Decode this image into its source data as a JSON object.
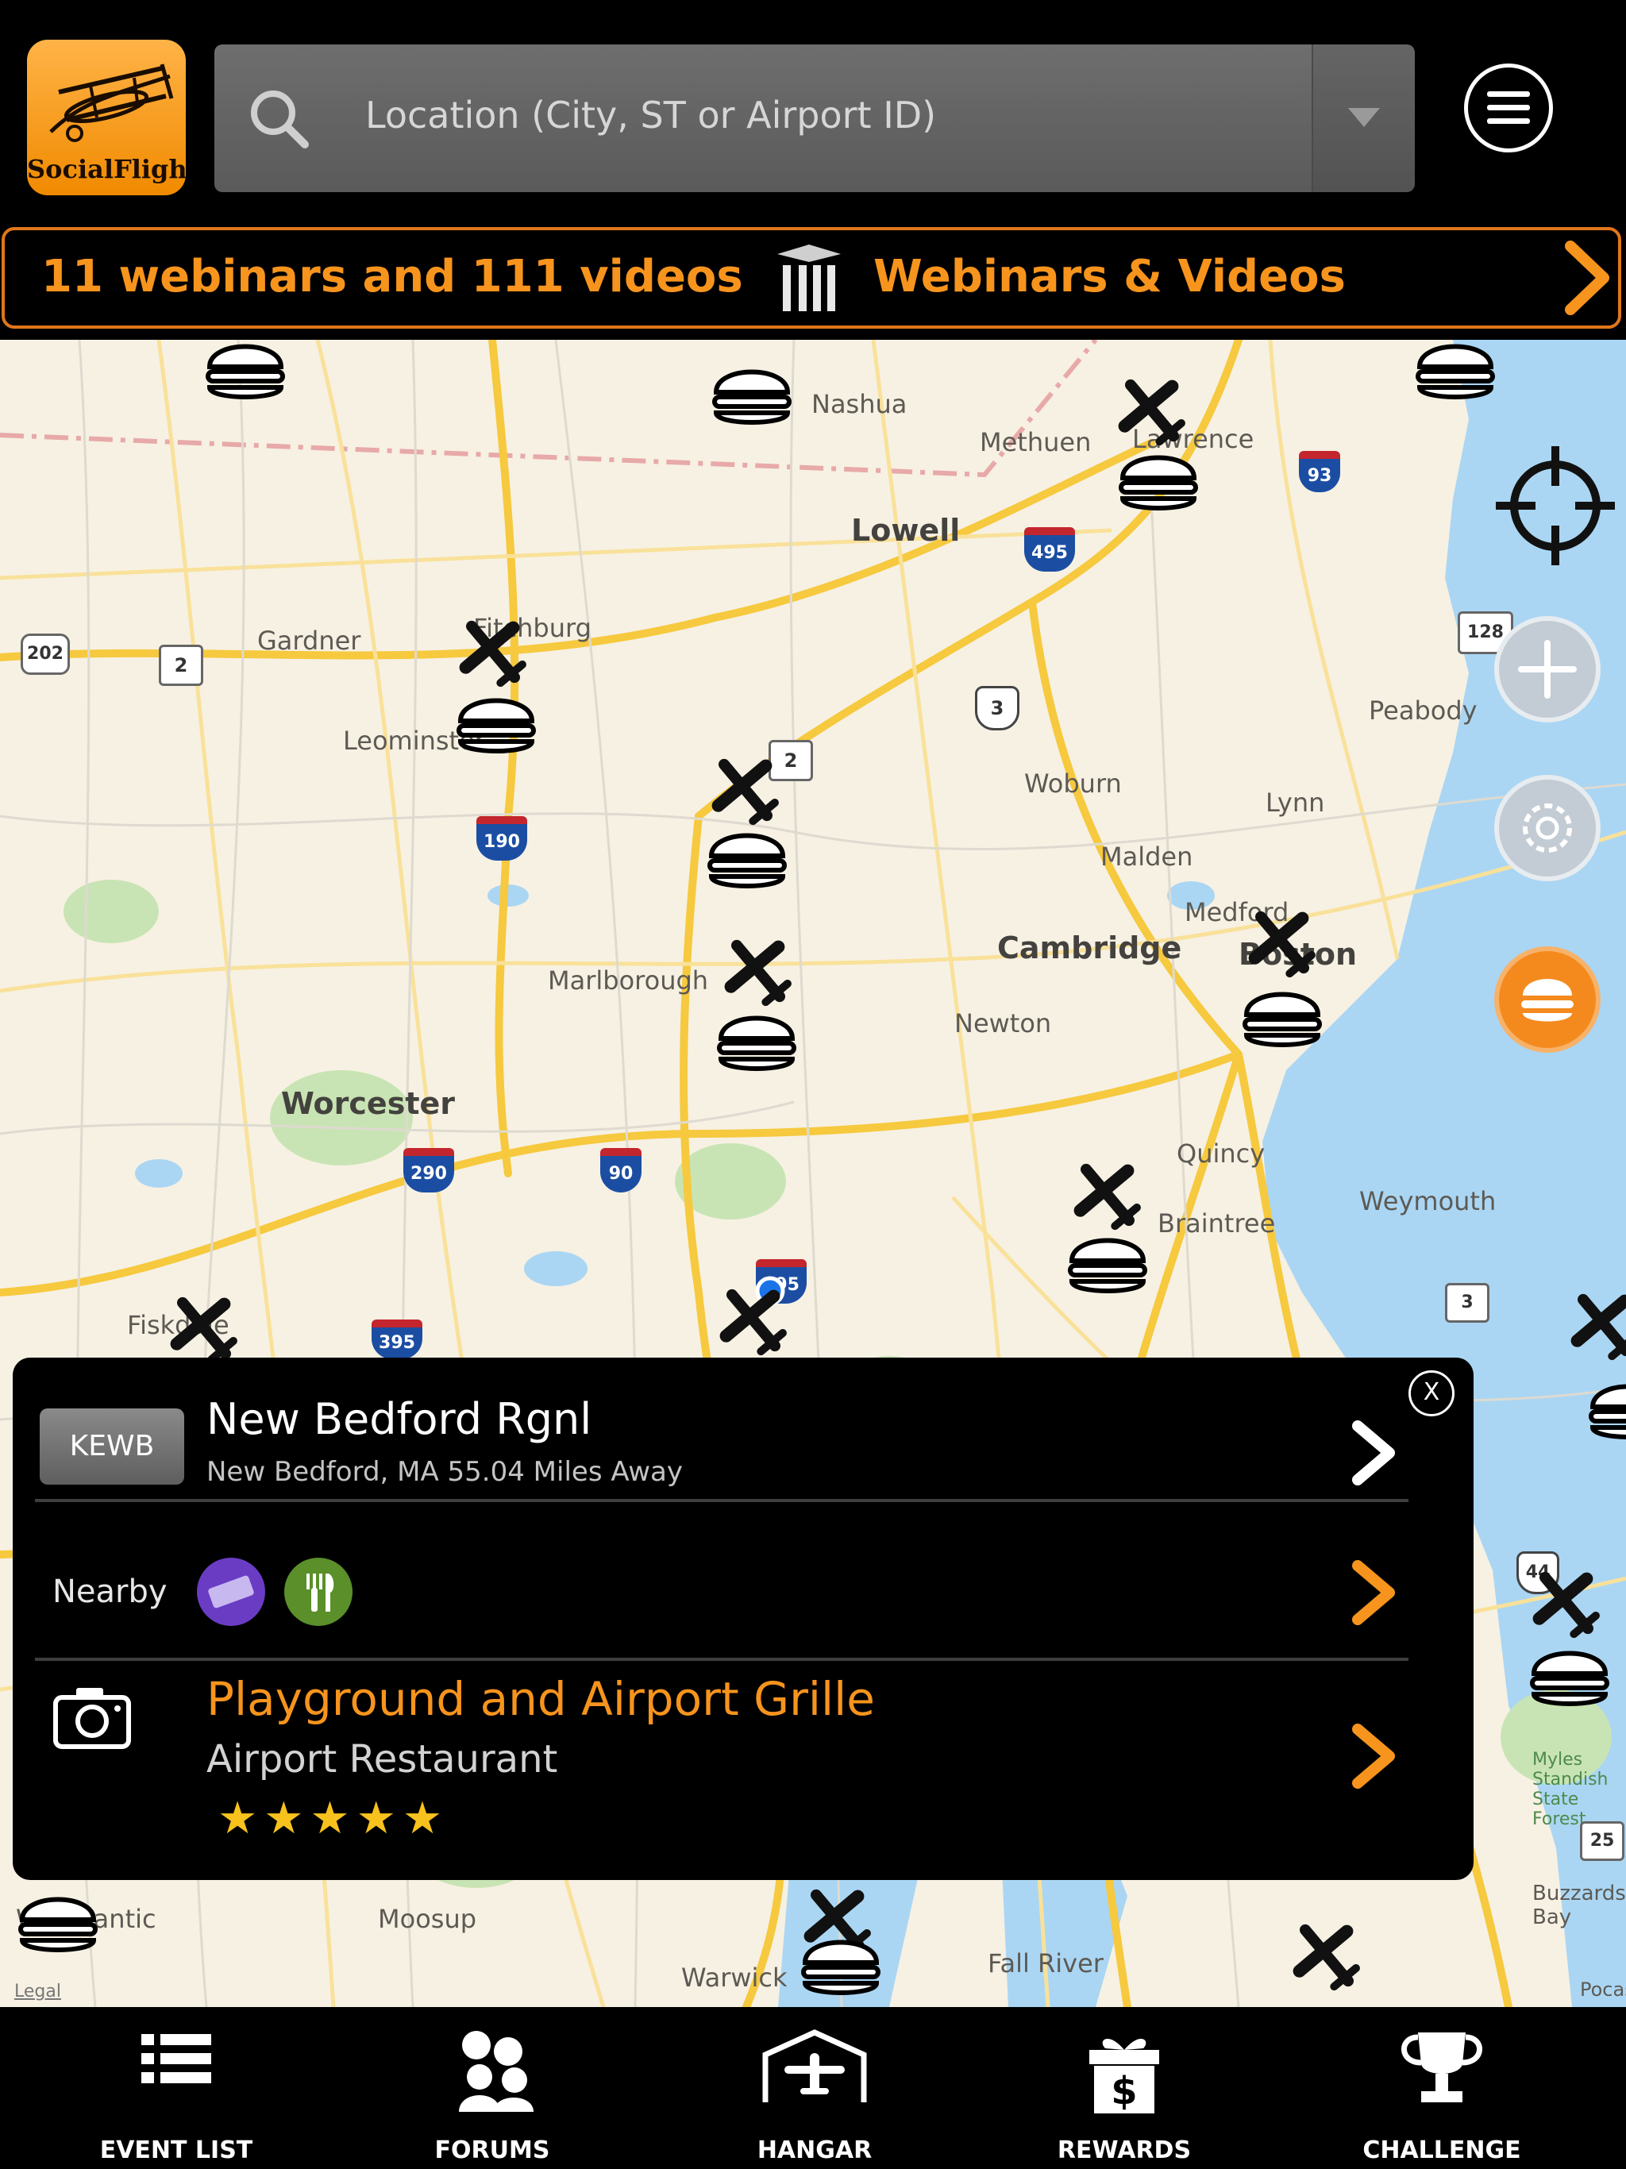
{
  "header": {
    "logo_text": "SocialFlight",
    "search_placeholder": "Location (City, ST or Airport ID)"
  },
  "banner": {
    "left_text": "11 webinars and 111 videos",
    "right_text": "Webinars & Videos"
  },
  "map": {
    "cities": [
      "Nashua",
      "Methuen",
      "Lawrence",
      "Lowell",
      "Fitchburg",
      "Gardner",
      "Leominster",
      "Peabody",
      "Woburn",
      "Lynn",
      "Malden",
      "Medford",
      "Cambridge",
      "Boston",
      "Marlborough",
      "Newton",
      "Worcester",
      "Quincy",
      "Weymouth",
      "Braintree",
      "Fall River",
      "Warwick",
      "Moosup",
      "Willimantic",
      "Fiskdale",
      "Myles Standish State Forest",
      "Buzzards Bay",
      "Pocasset"
    ],
    "shields": [
      "202",
      "2",
      "2",
      "3",
      "93",
      "495",
      "128",
      "190",
      "290",
      "90",
      "495",
      "395",
      "3",
      "44",
      "25"
    ],
    "legal_label": "Legal"
  },
  "card": {
    "airport_id": "KEWB",
    "airport_name": "New Bedford Rgnl",
    "airport_location": "New Bedford, MA 55.04 Miles Away",
    "close_label": "X",
    "nearby_label": "Nearby",
    "nearby_icons": [
      "ticket-icon",
      "restaurant-icon"
    ],
    "restaurant_name": "Playground and Airport Grille",
    "restaurant_type": "Airport Restaurant",
    "rating": 5,
    "stars_text": "★★★★★"
  },
  "tabs": [
    {
      "label": "EVENT LIST",
      "icon": "list-icon"
    },
    {
      "label": "FORUMS",
      "icon": "people-icon"
    },
    {
      "label": "HANGAR",
      "icon": "hangar-icon"
    },
    {
      "label": "REWARDS",
      "icon": "gift-dollar-icon"
    },
    {
      "label": "CHALLENGE",
      "icon": "trophy-icon"
    }
  ],
  "colors": {
    "accent_orange": "#f7941d",
    "map_bg": "#f7f1e3",
    "water": "#aad6f3",
    "park": "#c9e4b4",
    "road": "#f6c93e"
  }
}
